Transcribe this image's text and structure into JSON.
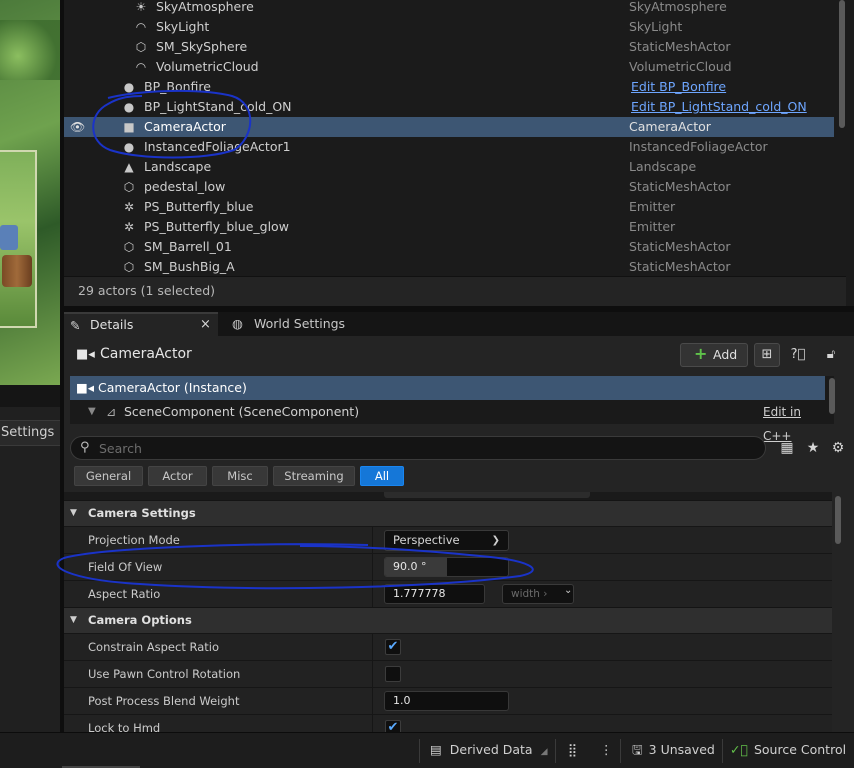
{
  "left_panel": {
    "settings_label": "Settings"
  },
  "outliner": {
    "rows": [
      {
        "name": "SkyAtmosphere",
        "type": "SkyAtmosphere",
        "icon": "sky-atmosphere-icon",
        "glyph": "☀",
        "indent": 2
      },
      {
        "name": "SkyLight",
        "type": "SkyLight",
        "icon": "sky-light-icon",
        "glyph": "◠",
        "indent": 2
      },
      {
        "name": "SM_SkySphere",
        "type": "StaticMeshActor",
        "icon": "static-mesh-icon",
        "glyph": "⬡",
        "indent": 2
      },
      {
        "name": "VolumetricCloud",
        "type": "VolumetricCloud",
        "icon": "cloud-icon",
        "glyph": "◠",
        "indent": 2
      },
      {
        "name": "BP_Bonfire",
        "type": "Edit BP_Bonfire",
        "icon": "actor-sphere-icon",
        "glyph": "●",
        "indent": 1,
        "link": true
      },
      {
        "name": "BP_LightStand_cold_ON",
        "type": "Edit BP_LightStand_cold_ON",
        "icon": "actor-sphere-icon",
        "glyph": "●",
        "indent": 1,
        "link": true
      },
      {
        "name": "CameraActor",
        "type": "CameraActor",
        "icon": "camera-icon",
        "glyph": "■",
        "indent": 1,
        "selected": true
      },
      {
        "name": "InstancedFoliageActor1",
        "type": "InstancedFoliageActor",
        "icon": "actor-sphere-icon",
        "glyph": "●",
        "indent": 1
      },
      {
        "name": "Landscape",
        "type": "Landscape",
        "icon": "landscape-icon",
        "glyph": "▲",
        "indent": 1
      },
      {
        "name": "pedestal_low",
        "type": "StaticMeshActor",
        "icon": "static-mesh-icon",
        "glyph": "⬡",
        "indent": 1
      },
      {
        "name": "PS_Butterfly_blue",
        "type": "Emitter",
        "icon": "emitter-icon",
        "glyph": "✲",
        "indent": 1
      },
      {
        "name": "PS_Butterfly_blue_glow",
        "type": "Emitter",
        "icon": "emitter-icon",
        "glyph": "✲",
        "indent": 1
      },
      {
        "name": "SM_Barrell_01",
        "type": "StaticMeshActor",
        "icon": "static-mesh-icon",
        "glyph": "⬡",
        "indent": 1
      },
      {
        "name": "SM_BushBig_A",
        "type": "StaticMeshActor",
        "icon": "static-mesh-icon",
        "glyph": "⬡",
        "indent": 1
      }
    ],
    "status": "29 actors (1 selected)"
  },
  "tabs": {
    "details": "Details",
    "close": "×",
    "world_settings": "World Settings"
  },
  "details": {
    "actor_title": "CameraActor",
    "add_label": "Add",
    "add_plus": "+",
    "components": {
      "instance": "CameraActor (Instance)",
      "scene": "SceneComponent (SceneComponent)",
      "edit_cpp": "Edit in C++"
    },
    "search_placeholder": "Search",
    "filters": [
      "General",
      "Actor",
      "Misc",
      "Streaming",
      "All"
    ],
    "active_filter": "All",
    "categories": {
      "camera_settings": "Camera Settings",
      "camera_options": "Camera Options"
    },
    "props": {
      "projection_mode_label": "Projection Mode",
      "projection_mode_value": "Perspective",
      "fov_label": "Field Of View",
      "fov_value": "90.0 °",
      "fov_fill": 0.5,
      "aspect_label": "Aspect Ratio",
      "aspect_value": "1.777778",
      "aspect_chip": "width ›",
      "constrain_label": "Constrain Aspect Ratio",
      "constrain_checked": true,
      "pawn_label": "Use Pawn Control Rotation",
      "pawn_checked": false,
      "blend_label": "Post Process Blend Weight",
      "blend_value": "1.0",
      "lock_label": "Lock to Hmd"
    }
  },
  "statusbar": {
    "derived_data": "Derived Data",
    "unsaved": "3 Unsaved",
    "source_control": "Source Control"
  },
  "colors": {
    "accent": "#1577d8",
    "selection": "#3d5673",
    "link": "#6ea6ff",
    "annotation": "#1a33c8"
  }
}
